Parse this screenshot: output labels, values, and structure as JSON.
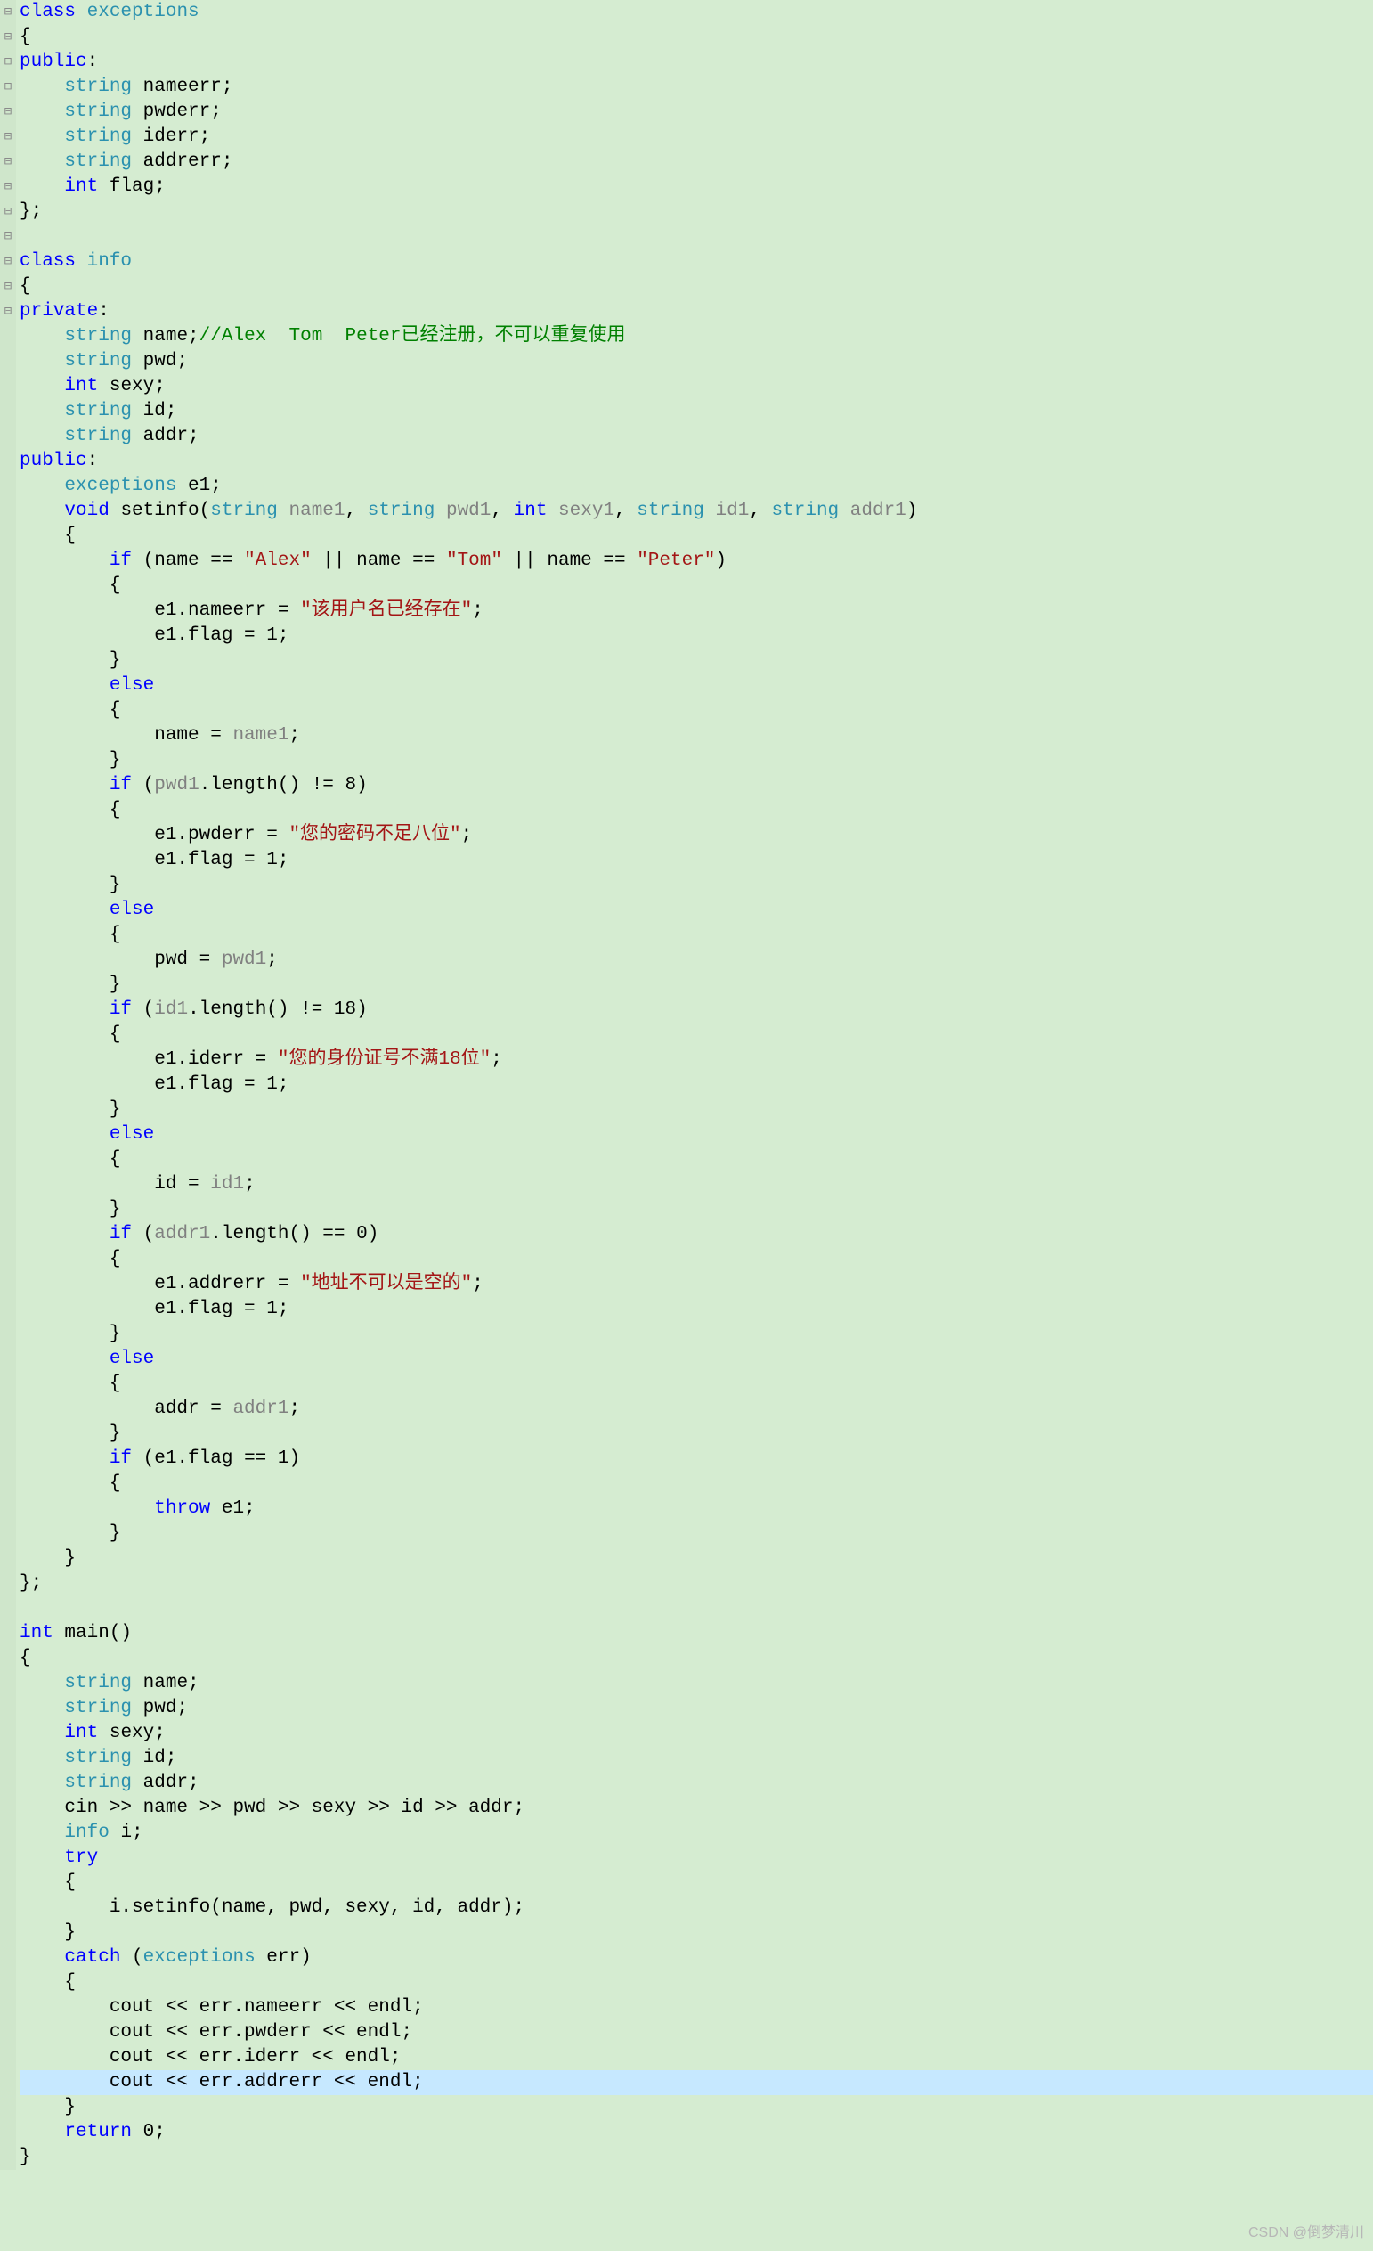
{
  "watermark": "CSDN @倒梦清川",
  "gutter": [
    "⊟",
    "",
    "",
    "",
    "",
    "",
    "",
    "",
    "",
    "",
    "⊟",
    "",
    "",
    "",
    "",
    "",
    "",
    "",
    "",
    "",
    "",
    "⊟",
    "",
    "⊟",
    "",
    "",
    "",
    "",
    "⊟",
    "",
    "",
    "",
    "",
    "⊟",
    "",
    "",
    "",
    "",
    "⊟",
    "",
    "",
    "",
    "",
    "⊟",
    "",
    "",
    "",
    "",
    "⊟",
    "",
    "",
    "",
    "",
    "⊟",
    "",
    "",
    "",
    "",
    "",
    "",
    "⊟",
    "",
    "",
    "",
    "",
    "",
    "",
    "",
    "",
    "⊟",
    "",
    "",
    "",
    "⊟",
    "",
    "",
    "",
    "",
    "",
    "",
    "",
    ""
  ],
  "code": [
    [
      {
        "c": "kw",
        "t": "class"
      },
      {
        "t": " "
      },
      {
        "c": "type",
        "t": "exceptions"
      }
    ],
    [
      {
        "t": "{"
      }
    ],
    [
      {
        "c": "kw",
        "t": "public"
      },
      {
        "t": ":"
      }
    ],
    [
      {
        "t": "    "
      },
      {
        "c": "type",
        "t": "string"
      },
      {
        "t": " nameerr;"
      }
    ],
    [
      {
        "t": "    "
      },
      {
        "c": "type",
        "t": "string"
      },
      {
        "t": " pwderr;"
      }
    ],
    [
      {
        "t": "    "
      },
      {
        "c": "type",
        "t": "string"
      },
      {
        "t": " iderr;"
      }
    ],
    [
      {
        "t": "    "
      },
      {
        "c": "type",
        "t": "string"
      },
      {
        "t": " addrerr;"
      }
    ],
    [
      {
        "t": "    "
      },
      {
        "c": "kw",
        "t": "int"
      },
      {
        "t": " flag;"
      }
    ],
    [
      {
        "t": "};"
      }
    ],
    [
      {
        "t": ""
      }
    ],
    [
      {
        "c": "kw",
        "t": "class"
      },
      {
        "t": " "
      },
      {
        "c": "type",
        "t": "info"
      }
    ],
    [
      {
        "t": "{"
      }
    ],
    [
      {
        "c": "kw",
        "t": "private"
      },
      {
        "t": ":"
      }
    ],
    [
      {
        "t": "    "
      },
      {
        "c": "type",
        "t": "string"
      },
      {
        "t": " name;"
      },
      {
        "c": "cmt",
        "t": "//Alex  Tom  Peter已经注册，不可以重复使用"
      }
    ],
    [
      {
        "t": "    "
      },
      {
        "c": "type",
        "t": "string"
      },
      {
        "t": " pwd;"
      }
    ],
    [
      {
        "t": "    "
      },
      {
        "c": "kw",
        "t": "int"
      },
      {
        "t": " sexy;"
      }
    ],
    [
      {
        "t": "    "
      },
      {
        "c": "type",
        "t": "string"
      },
      {
        "t": " id;"
      }
    ],
    [
      {
        "t": "    "
      },
      {
        "c": "type",
        "t": "string"
      },
      {
        "t": " addr;"
      }
    ],
    [
      {
        "c": "kw",
        "t": "public"
      },
      {
        "t": ":"
      }
    ],
    [
      {
        "t": "    "
      },
      {
        "c": "type",
        "t": "exceptions"
      },
      {
        "t": " e1;"
      }
    ],
    [
      {
        "t": "    "
      },
      {
        "c": "kw",
        "t": "void"
      },
      {
        "t": " setinfo("
      },
      {
        "c": "type",
        "t": "string"
      },
      {
        "t": " "
      },
      {
        "c": "id3",
        "t": "name1"
      },
      {
        "t": ", "
      },
      {
        "c": "type",
        "t": "string"
      },
      {
        "t": " "
      },
      {
        "c": "id3",
        "t": "pwd1"
      },
      {
        "t": ", "
      },
      {
        "c": "kw",
        "t": "int"
      },
      {
        "t": " "
      },
      {
        "c": "id3",
        "t": "sexy1"
      },
      {
        "t": ", "
      },
      {
        "c": "type",
        "t": "string"
      },
      {
        "t": " "
      },
      {
        "c": "id3",
        "t": "id1"
      },
      {
        "t": ", "
      },
      {
        "c": "type",
        "t": "string"
      },
      {
        "t": " "
      },
      {
        "c": "id3",
        "t": "addr1"
      },
      {
        "t": ")"
      }
    ],
    [
      {
        "t": "    {"
      }
    ],
    [
      {
        "t": "        "
      },
      {
        "c": "kw",
        "t": "if"
      },
      {
        "t": " (name == "
      },
      {
        "c": "str",
        "t": "\"Alex\""
      },
      {
        "t": " || name == "
      },
      {
        "c": "str",
        "t": "\"Tom\""
      },
      {
        "t": " || name == "
      },
      {
        "c": "str",
        "t": "\"Peter\""
      },
      {
        "t": ")"
      }
    ],
    [
      {
        "t": "        {"
      }
    ],
    [
      {
        "t": "            e1.nameerr = "
      },
      {
        "c": "str",
        "t": "\"该用户名已经存在\""
      },
      {
        "t": ";"
      }
    ],
    [
      {
        "t": "            e1.flag = 1;"
      }
    ],
    [
      {
        "t": "        }"
      }
    ],
    [
      {
        "t": "        "
      },
      {
        "c": "kw",
        "t": "else"
      }
    ],
    [
      {
        "t": "        {"
      }
    ],
    [
      {
        "t": "            name = "
      },
      {
        "c": "id3",
        "t": "name1"
      },
      {
        "t": ";"
      }
    ],
    [
      {
        "t": "        }"
      }
    ],
    [
      {
        "t": "        "
      },
      {
        "c": "kw",
        "t": "if"
      },
      {
        "t": " ("
      },
      {
        "c": "id3",
        "t": "pwd1"
      },
      {
        "t": ".length() != 8)"
      }
    ],
    [
      {
        "t": "        {"
      }
    ],
    [
      {
        "t": "            e1.pwderr = "
      },
      {
        "c": "str",
        "t": "\"您的密码不足八位\""
      },
      {
        "t": ";"
      }
    ],
    [
      {
        "t": "            e1.flag = 1;"
      }
    ],
    [
      {
        "t": "        }"
      }
    ],
    [
      {
        "t": "        "
      },
      {
        "c": "kw",
        "t": "else"
      }
    ],
    [
      {
        "t": "        {"
      }
    ],
    [
      {
        "t": "            pwd = "
      },
      {
        "c": "id3",
        "t": "pwd1"
      },
      {
        "t": ";"
      }
    ],
    [
      {
        "t": "        }"
      }
    ],
    [
      {
        "t": "        "
      },
      {
        "c": "kw",
        "t": "if"
      },
      {
        "t": " ("
      },
      {
        "c": "id3",
        "t": "id1"
      },
      {
        "t": ".length() != 18)"
      }
    ],
    [
      {
        "t": "        {"
      }
    ],
    [
      {
        "t": "            e1.iderr = "
      },
      {
        "c": "str",
        "t": "\"您的身份证号不满18位\""
      },
      {
        "t": ";"
      }
    ],
    [
      {
        "t": "            e1.flag = 1;"
      }
    ],
    [
      {
        "t": "        }"
      }
    ],
    [
      {
        "t": "        "
      },
      {
        "c": "kw",
        "t": "else"
      }
    ],
    [
      {
        "t": "        {"
      }
    ],
    [
      {
        "t": "            id = "
      },
      {
        "c": "id3",
        "t": "id1"
      },
      {
        "t": ";"
      }
    ],
    [
      {
        "t": "        }"
      }
    ],
    [
      {
        "t": "        "
      },
      {
        "c": "kw",
        "t": "if"
      },
      {
        "t": " ("
      },
      {
        "c": "id3",
        "t": "addr1"
      },
      {
        "t": ".length() == 0)"
      }
    ],
    [
      {
        "t": "        {"
      }
    ],
    [
      {
        "t": "            e1.addrerr = "
      },
      {
        "c": "str",
        "t": "\"地址不可以是空的\""
      },
      {
        "t": ";"
      }
    ],
    [
      {
        "t": "            e1.flag = 1;"
      }
    ],
    [
      {
        "t": "        }"
      }
    ],
    [
      {
        "t": "        "
      },
      {
        "c": "kw",
        "t": "else"
      }
    ],
    [
      {
        "t": "        {"
      }
    ],
    [
      {
        "t": "            addr = "
      },
      {
        "c": "id3",
        "t": "addr1"
      },
      {
        "t": ";"
      }
    ],
    [
      {
        "t": "        }"
      }
    ],
    [
      {
        "t": "        "
      },
      {
        "c": "kw",
        "t": "if"
      },
      {
        "t": " (e1.flag == 1)"
      }
    ],
    [
      {
        "t": "        {"
      }
    ],
    [
      {
        "t": "            "
      },
      {
        "c": "kw",
        "t": "throw"
      },
      {
        "t": " e1;"
      }
    ],
    [
      {
        "t": "        }"
      }
    ],
    [
      {
        "t": "    }"
      }
    ],
    [
      {
        "t": "};"
      }
    ],
    [
      {
        "t": ""
      }
    ],
    [
      {
        "c": "kw",
        "t": "int"
      },
      {
        "t": " main()"
      }
    ],
    [
      {
        "t": "{"
      }
    ],
    [
      {
        "t": "    "
      },
      {
        "c": "type",
        "t": "string"
      },
      {
        "t": " name;"
      }
    ],
    [
      {
        "t": "    "
      },
      {
        "c": "type",
        "t": "string"
      },
      {
        "t": " pwd;"
      }
    ],
    [
      {
        "t": "    "
      },
      {
        "c": "kw",
        "t": "int"
      },
      {
        "t": " sexy;"
      }
    ],
    [
      {
        "t": "    "
      },
      {
        "c": "type",
        "t": "string"
      },
      {
        "t": " id;"
      }
    ],
    [
      {
        "t": "    "
      },
      {
        "c": "type",
        "t": "string"
      },
      {
        "t": " addr;"
      }
    ],
    [
      {
        "t": "    cin >> name >> pwd >> sexy >> id >> addr;"
      }
    ],
    [
      {
        "t": "    "
      },
      {
        "c": "type",
        "t": "info"
      },
      {
        "t": " i;"
      }
    ],
    [
      {
        "t": "    "
      },
      {
        "c": "kw",
        "t": "try"
      }
    ],
    [
      {
        "t": "    {"
      }
    ],
    [
      {
        "t": "        i.setinfo(name, pwd, sexy, id, addr);"
      }
    ],
    [
      {
        "t": "    }"
      }
    ],
    [
      {
        "t": "    "
      },
      {
        "c": "kw",
        "t": "catch"
      },
      {
        "t": " ("
      },
      {
        "c": "type",
        "t": "exceptions"
      },
      {
        "t": " err)"
      }
    ],
    [
      {
        "t": "    {"
      }
    ],
    [
      {
        "t": "        cout << err.nameerr << endl;"
      }
    ],
    [
      {
        "t": "        cout << err.pwderr << endl;"
      }
    ],
    [
      {
        "t": "        cout << err.iderr << endl;"
      }
    ],
    [
      {
        "t": "        cout << err.addrerr << endl;",
        "hl": true
      }
    ],
    [
      {
        "t": "    }"
      }
    ],
    [
      {
        "t": "    "
      },
      {
        "c": "kw",
        "t": "return"
      },
      {
        "t": " 0;"
      }
    ],
    [
      {
        "t": "}"
      }
    ]
  ]
}
